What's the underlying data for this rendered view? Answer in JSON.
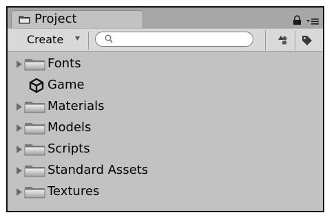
{
  "window": {
    "tab_title": "Project",
    "tab_icon": "folder-icon",
    "header_icons": [
      "lock-icon",
      "panel-menu-icon"
    ]
  },
  "toolbar": {
    "create_label": "Create",
    "search_value": "",
    "search_placeholder": "",
    "icons": [
      "search-icon",
      "filter-by-type-icon",
      "filter-by-label-icon"
    ]
  },
  "items": [
    {
      "label": "Fonts",
      "type": "folder",
      "expandable": true
    },
    {
      "label": "Game",
      "type": "scene",
      "expandable": false
    },
    {
      "label": "Materials",
      "type": "folder",
      "expandable": true
    },
    {
      "label": "Models",
      "type": "folder",
      "expandable": true
    },
    {
      "label": "Scripts",
      "type": "folder",
      "expandable": true
    },
    {
      "label": "Standard Assets",
      "type": "folder",
      "expandable": true
    },
    {
      "label": "Textures",
      "type": "folder",
      "expandable": true
    }
  ],
  "colors": {
    "panel_bg": "#c2c2c2",
    "tabbar_bg": "#a7a7a7",
    "toolbar_bg": "#d9d9d9",
    "border": "#111111"
  }
}
